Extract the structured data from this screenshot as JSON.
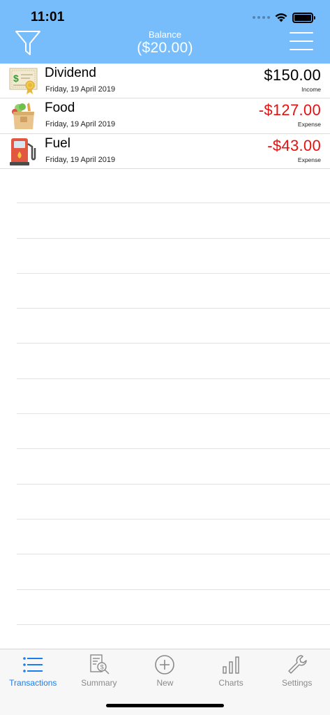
{
  "status_bar": {
    "time": "11:01"
  },
  "header": {
    "balance_label": "Balance",
    "balance_value": "($20.00)"
  },
  "transactions": [
    {
      "title": "Dividend",
      "date": "Friday, 19 April 2019",
      "amount": "$150.00",
      "type": "Income",
      "icon": "certificate-icon",
      "color": "#000000"
    },
    {
      "title": "Food",
      "date": "Friday, 19 April 2019",
      "amount": "-$127.00",
      "type": "Expense",
      "icon": "grocery-bag-icon",
      "color": "#e8100f"
    },
    {
      "title": "Fuel",
      "date": "Friday, 19 April 2019",
      "amount": "-$43.00",
      "type": "Expense",
      "icon": "fuel-pump-icon",
      "color": "#e8100f"
    }
  ],
  "tabs": [
    {
      "label": "Transactions",
      "icon": "list-icon",
      "active": true
    },
    {
      "label": "Summary",
      "icon": "summary-report-icon",
      "active": false
    },
    {
      "label": "New",
      "icon": "add-circle-icon",
      "active": false
    },
    {
      "label": "Charts",
      "icon": "bar-chart-icon",
      "active": false
    },
    {
      "label": "Settings",
      "icon": "wrench-icon",
      "active": false
    }
  ],
  "colors": {
    "header": "#78bdfb",
    "accent": "#1b7cf2",
    "expense": "#e8100f"
  }
}
